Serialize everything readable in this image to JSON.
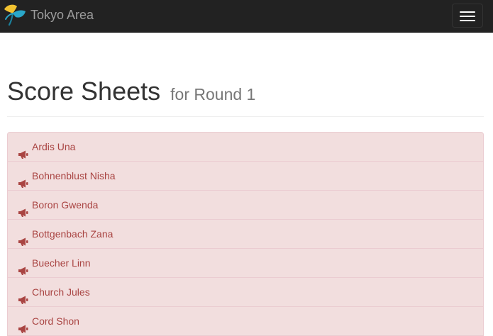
{
  "navbar": {
    "brand_text": "Tokyo Area",
    "brand_icon": "ginkgo-leaf-logo",
    "toggle_icon": "hamburger-menu-icon",
    "background": "#222222"
  },
  "header": {
    "title": "Score Sheets",
    "subtitle": "for Round 1"
  },
  "list": {
    "item_icon": "bullhorn-icon",
    "text_color": "#a94442",
    "background": "#f2dede",
    "items": [
      {
        "label": "Ardis Una"
      },
      {
        "label": "Bohnenblust Nisha"
      },
      {
        "label": "Boron Gwenda"
      },
      {
        "label": "Bottgenbach Zana"
      },
      {
        "label": "Buecher Linn"
      },
      {
        "label": "Church Jules"
      },
      {
        "label": "Cord Shon"
      }
    ]
  }
}
